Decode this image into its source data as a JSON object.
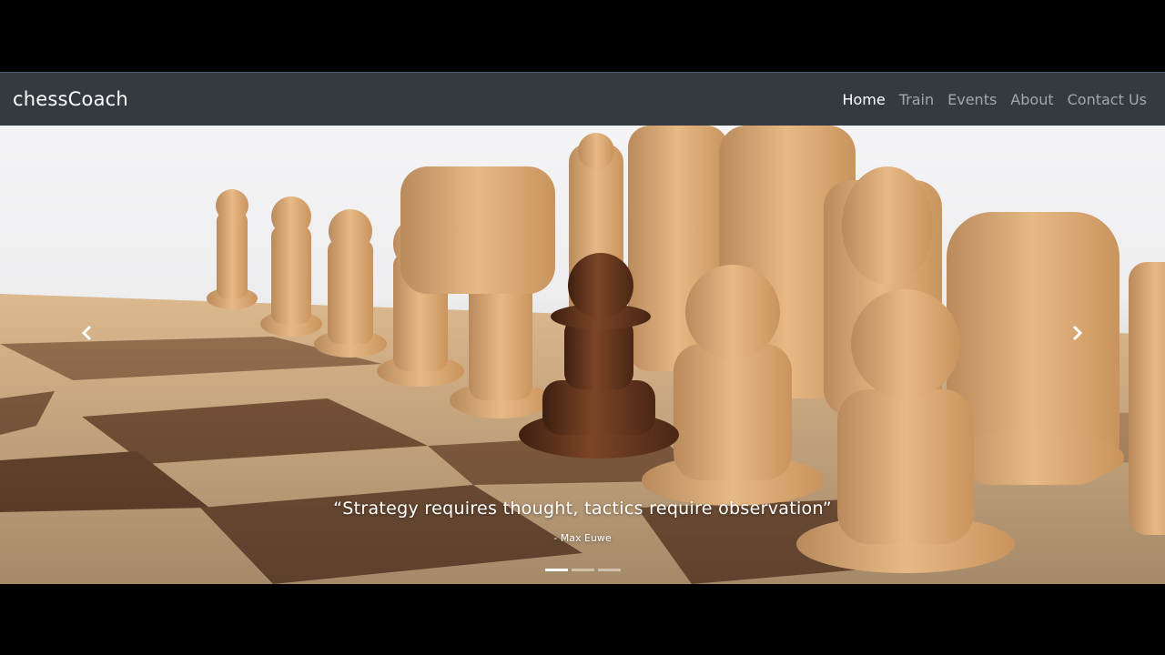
{
  "navbar": {
    "brand": "chessCoach",
    "links": [
      {
        "label": "Home",
        "active": true
      },
      {
        "label": "Train",
        "active": false
      },
      {
        "label": "Events",
        "active": false
      },
      {
        "label": "About",
        "active": false
      },
      {
        "label": "Contact Us",
        "active": false
      }
    ]
  },
  "carousel": {
    "quote": "“Strategy requires thought, tactics require observation”",
    "author": "- Max Euwe",
    "prev_icon": "chevron-left-icon",
    "next_icon": "chevron-right-icon",
    "indicator_count": 3,
    "active_indicator": 1,
    "image": "wooden chess pieces on board, one dark pawn among light pieces"
  },
  "colors": {
    "navbar_bg": "#343a40",
    "page_bg": "#000000",
    "light_wood": "#d9a46a",
    "dark_pawn": "#6b3a1e"
  }
}
